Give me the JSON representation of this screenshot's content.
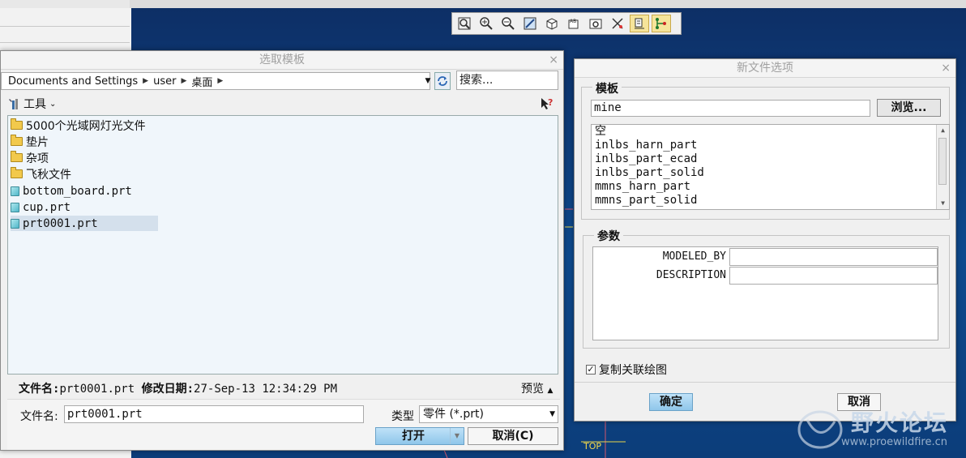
{
  "file_dialog": {
    "title": "选取模板",
    "close": "×",
    "path": [
      "Documents and Settings",
      "user",
      "桌面"
    ],
    "search_placeholder": "搜索...",
    "tools_label": "工具",
    "files": [
      {
        "name": "5000个光域网灯光文件",
        "type": "folder"
      },
      {
        "name": "垫片",
        "type": "folder"
      },
      {
        "name": "杂项",
        "type": "folder"
      },
      {
        "name": "飞秋文件",
        "type": "folder"
      },
      {
        "name": "bottom_board.prt",
        "type": "part"
      },
      {
        "name": "cup.prt",
        "type": "part"
      },
      {
        "name": "prt0001.prt",
        "type": "part",
        "selected": true
      }
    ],
    "info_name_label": "文件名:",
    "info_name_value": "prt0001.prt",
    "info_date_label": "修改日期:",
    "info_date_value": "27-Sep-13 12:34:29 PM",
    "preview_label": "预览",
    "filename_label": "文件名:",
    "filename_value": "prt0001.prt",
    "type_label": "类型",
    "type_value": "零件 (*.prt)",
    "open_label": "打开",
    "cancel_label": "取消(C)"
  },
  "new_file_options": {
    "title": "新文件选项",
    "close": "×",
    "template_group": "模板",
    "template_value": "mine",
    "browse_label": "浏览...",
    "templates": [
      "空",
      "inlbs_harn_part",
      "inlbs_part_ecad",
      "inlbs_part_solid",
      "mmns_harn_part",
      "mmns_part_solid"
    ],
    "params_group": "参数",
    "params": [
      {
        "name": "MODELED_BY",
        "value": ""
      },
      {
        "name": "DESCRIPTION",
        "value": ""
      }
    ],
    "copy_drawing_label": "复制关联绘图",
    "copy_drawing_checked": true,
    "ok_label": "确定",
    "cancel_label": "取消"
  },
  "canvas": {
    "datum_label": "TOP"
  },
  "watermark": {
    "text": "野火论坛",
    "url": "www.proewildfire.cn"
  },
  "colors": {
    "canvas": "#0d3a78",
    "primary_button": "#8fc6ea",
    "selection": "#d4e0ec"
  }
}
